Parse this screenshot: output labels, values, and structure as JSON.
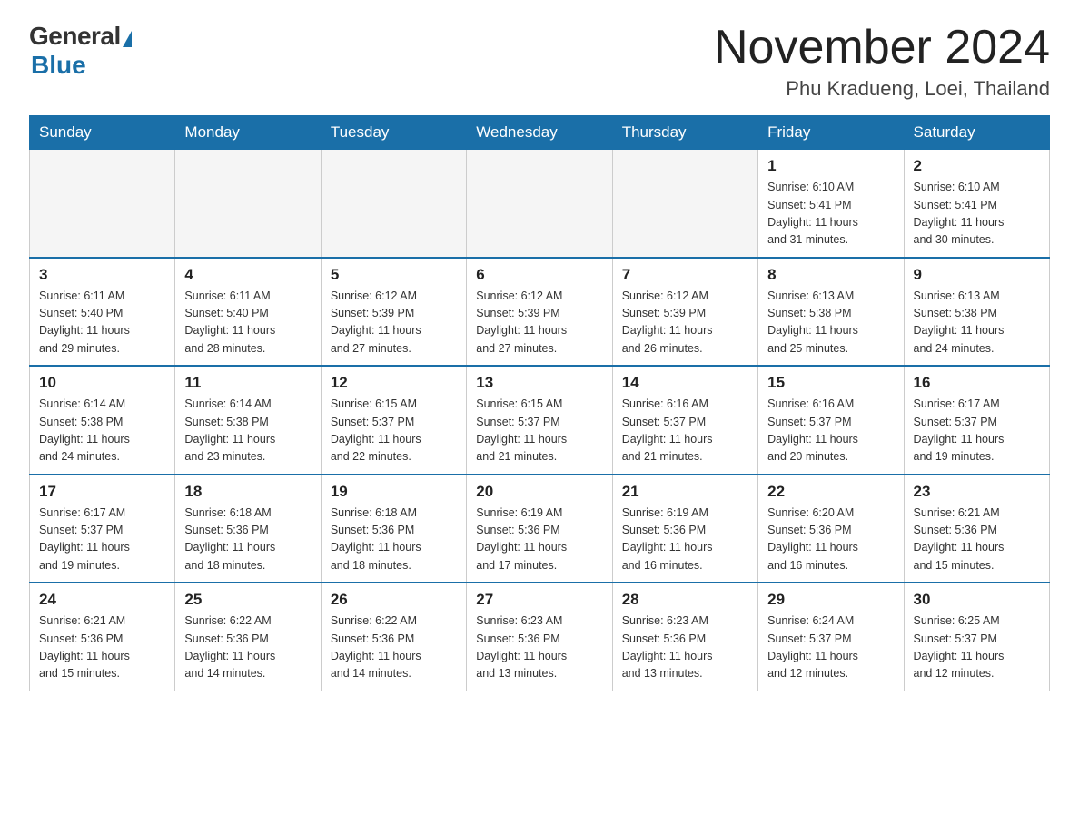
{
  "logo": {
    "general": "General",
    "blue": "Blue",
    "subtitle": "Blue"
  },
  "header": {
    "month": "November 2024",
    "location": "Phu Kradueng, Loei, Thailand"
  },
  "days_of_week": [
    "Sunday",
    "Monday",
    "Tuesday",
    "Wednesday",
    "Thursday",
    "Friday",
    "Saturday"
  ],
  "weeks": [
    [
      {
        "day": "",
        "info": ""
      },
      {
        "day": "",
        "info": ""
      },
      {
        "day": "",
        "info": ""
      },
      {
        "day": "",
        "info": ""
      },
      {
        "day": "",
        "info": ""
      },
      {
        "day": "1",
        "info": "Sunrise: 6:10 AM\nSunset: 5:41 PM\nDaylight: 11 hours\nand 31 minutes."
      },
      {
        "day": "2",
        "info": "Sunrise: 6:10 AM\nSunset: 5:41 PM\nDaylight: 11 hours\nand 30 minutes."
      }
    ],
    [
      {
        "day": "3",
        "info": "Sunrise: 6:11 AM\nSunset: 5:40 PM\nDaylight: 11 hours\nand 29 minutes."
      },
      {
        "day": "4",
        "info": "Sunrise: 6:11 AM\nSunset: 5:40 PM\nDaylight: 11 hours\nand 28 minutes."
      },
      {
        "day": "5",
        "info": "Sunrise: 6:12 AM\nSunset: 5:39 PM\nDaylight: 11 hours\nand 27 minutes."
      },
      {
        "day": "6",
        "info": "Sunrise: 6:12 AM\nSunset: 5:39 PM\nDaylight: 11 hours\nand 27 minutes."
      },
      {
        "day": "7",
        "info": "Sunrise: 6:12 AM\nSunset: 5:39 PM\nDaylight: 11 hours\nand 26 minutes."
      },
      {
        "day": "8",
        "info": "Sunrise: 6:13 AM\nSunset: 5:38 PM\nDaylight: 11 hours\nand 25 minutes."
      },
      {
        "day": "9",
        "info": "Sunrise: 6:13 AM\nSunset: 5:38 PM\nDaylight: 11 hours\nand 24 minutes."
      }
    ],
    [
      {
        "day": "10",
        "info": "Sunrise: 6:14 AM\nSunset: 5:38 PM\nDaylight: 11 hours\nand 24 minutes."
      },
      {
        "day": "11",
        "info": "Sunrise: 6:14 AM\nSunset: 5:38 PM\nDaylight: 11 hours\nand 23 minutes."
      },
      {
        "day": "12",
        "info": "Sunrise: 6:15 AM\nSunset: 5:37 PM\nDaylight: 11 hours\nand 22 minutes."
      },
      {
        "day": "13",
        "info": "Sunrise: 6:15 AM\nSunset: 5:37 PM\nDaylight: 11 hours\nand 21 minutes."
      },
      {
        "day": "14",
        "info": "Sunrise: 6:16 AM\nSunset: 5:37 PM\nDaylight: 11 hours\nand 21 minutes."
      },
      {
        "day": "15",
        "info": "Sunrise: 6:16 AM\nSunset: 5:37 PM\nDaylight: 11 hours\nand 20 minutes."
      },
      {
        "day": "16",
        "info": "Sunrise: 6:17 AM\nSunset: 5:37 PM\nDaylight: 11 hours\nand 19 minutes."
      }
    ],
    [
      {
        "day": "17",
        "info": "Sunrise: 6:17 AM\nSunset: 5:37 PM\nDaylight: 11 hours\nand 19 minutes."
      },
      {
        "day": "18",
        "info": "Sunrise: 6:18 AM\nSunset: 5:36 PM\nDaylight: 11 hours\nand 18 minutes."
      },
      {
        "day": "19",
        "info": "Sunrise: 6:18 AM\nSunset: 5:36 PM\nDaylight: 11 hours\nand 18 minutes."
      },
      {
        "day": "20",
        "info": "Sunrise: 6:19 AM\nSunset: 5:36 PM\nDaylight: 11 hours\nand 17 minutes."
      },
      {
        "day": "21",
        "info": "Sunrise: 6:19 AM\nSunset: 5:36 PM\nDaylight: 11 hours\nand 16 minutes."
      },
      {
        "day": "22",
        "info": "Sunrise: 6:20 AM\nSunset: 5:36 PM\nDaylight: 11 hours\nand 16 minutes."
      },
      {
        "day": "23",
        "info": "Sunrise: 6:21 AM\nSunset: 5:36 PM\nDaylight: 11 hours\nand 15 minutes."
      }
    ],
    [
      {
        "day": "24",
        "info": "Sunrise: 6:21 AM\nSunset: 5:36 PM\nDaylight: 11 hours\nand 15 minutes."
      },
      {
        "day": "25",
        "info": "Sunrise: 6:22 AM\nSunset: 5:36 PM\nDaylight: 11 hours\nand 14 minutes."
      },
      {
        "day": "26",
        "info": "Sunrise: 6:22 AM\nSunset: 5:36 PM\nDaylight: 11 hours\nand 14 minutes."
      },
      {
        "day": "27",
        "info": "Sunrise: 6:23 AM\nSunset: 5:36 PM\nDaylight: 11 hours\nand 13 minutes."
      },
      {
        "day": "28",
        "info": "Sunrise: 6:23 AM\nSunset: 5:36 PM\nDaylight: 11 hours\nand 13 minutes."
      },
      {
        "day": "29",
        "info": "Sunrise: 6:24 AM\nSunset: 5:37 PM\nDaylight: 11 hours\nand 12 minutes."
      },
      {
        "day": "30",
        "info": "Sunrise: 6:25 AM\nSunset: 5:37 PM\nDaylight: 11 hours\nand 12 minutes."
      }
    ]
  ]
}
